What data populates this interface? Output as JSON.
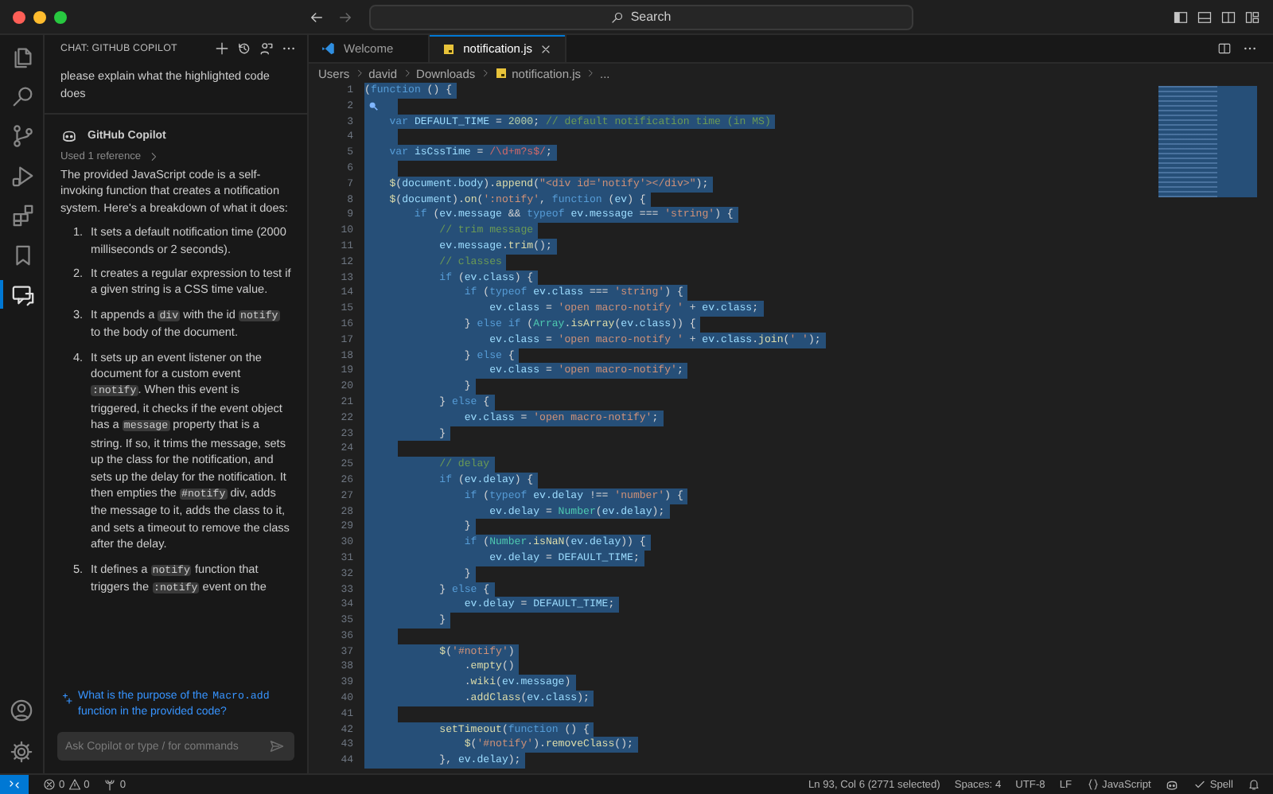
{
  "title_bar": {
    "search_label": "Search"
  },
  "activity_bar": {
    "items": [
      {
        "kind": "files",
        "selected": false
      },
      {
        "kind": "search",
        "selected": false
      },
      {
        "kind": "source-control",
        "selected": false
      },
      {
        "kind": "run",
        "selected": false
      },
      {
        "kind": "extensions",
        "selected": false
      },
      {
        "kind": "bookmark",
        "selected": false
      },
      {
        "kind": "chat",
        "selected": true
      }
    ],
    "bottom": [
      {
        "kind": "account"
      },
      {
        "kind": "settings"
      }
    ]
  },
  "chat": {
    "title": "CHAT: GITHUB COPILOT",
    "question": "please explain what the highlighted code does",
    "response": {
      "author": "GitHub Copilot",
      "reference": "Used 1 reference",
      "intro": "The provided JavaScript code is a self-invoking function that creates a notification system. Here's a breakdown of what it does:",
      "steps": [
        {
          "number": "1.",
          "parts": [
            {
              "kind": "text",
              "text": "It sets a default notification time (2000 milliseconds or 2 seconds)."
            }
          ]
        },
        {
          "number": "2.",
          "parts": [
            {
              "kind": "text",
              "text": "It creates a regular expression to test if a given string is a CSS time value."
            }
          ]
        },
        {
          "number": "3.",
          "parts": [
            {
              "kind": "text",
              "text": "It appends a "
            },
            {
              "kind": "code",
              "text": "div"
            },
            {
              "kind": "text",
              "text": " with the id "
            },
            {
              "kind": "code",
              "text": "notify"
            },
            {
              "kind": "text",
              "text": " to the body of the document."
            }
          ]
        },
        {
          "number": "4.",
          "parts": [
            {
              "kind": "text",
              "text": "It sets up an event listener on the document for a custom event "
            },
            {
              "kind": "code",
              "text": ":notify"
            },
            {
              "kind": "text",
              "text": ". When this event is triggered, it checks if the event object has a "
            },
            {
              "kind": "code",
              "text": "message"
            },
            {
              "kind": "text",
              "text": " property that is a string. If so, it trims the message, sets up the class for the notification, and sets up the delay for the notification. It then empties the "
            },
            {
              "kind": "code",
              "text": "#notify"
            },
            {
              "kind": "text",
              "text": " div, adds the message to it, adds the class to it, and sets a timeout to remove the class after the delay."
            }
          ]
        },
        {
          "number": "5.",
          "parts": [
            {
              "kind": "text",
              "text": "It defines a "
            },
            {
              "kind": "code",
              "text": "notify"
            },
            {
              "kind": "text",
              "text": " function that triggers the "
            },
            {
              "kind": "code",
              "text": ":notify"
            },
            {
              "kind": "text",
              "text": " event on the"
            }
          ]
        }
      ]
    },
    "followup": [
      {
        "kind": "text",
        "text": "What is the purpose of the "
      },
      {
        "kind": "code",
        "text": "Macro.add"
      },
      {
        "kind": "text",
        "text": " function in the provided code?"
      }
    ],
    "input": {
      "placeholder": "Ask Copilot or type / for commands"
    }
  },
  "editor": {
    "tabs": [
      {
        "label": "Welcome",
        "kind": "welcome",
        "selected": false
      },
      {
        "label": "notification.js",
        "kind": "js",
        "selected": true
      }
    ],
    "breadcrumb": [
      {
        "label": "Users",
        "kind": "folder"
      },
      {
        "label": "david",
        "kind": "folder"
      },
      {
        "label": "Downloads",
        "kind": "folder"
      },
      {
        "label": "notification.js",
        "kind": "js"
      },
      {
        "label": "...",
        "kind": "more"
      }
    ],
    "lines": [
      {
        "number": "1",
        "selected": true,
        "hint": false,
        "tokens": [
          {
            "kind": "p",
            "text": "("
          },
          {
            "kind": "kw",
            "text": "function"
          },
          {
            "kind": "p",
            "text": " () {"
          }
        ]
      },
      {
        "number": "2",
        "selected": true,
        "hint": true
      },
      {
        "number": "3",
        "selected": true,
        "hint": false,
        "tokens": [
          {
            "kind": "kw",
            "text": "    var"
          },
          {
            "kind": "vr",
            "text": " DEFAULT_TIME"
          },
          {
            "kind": "p",
            "text": " ="
          },
          {
            "kind": "nm",
            "text": " 2000"
          },
          {
            "kind": "p",
            "text": ";"
          },
          {
            "kind": "cm",
            "text": " // default notification time (in MS)"
          }
        ]
      },
      {
        "number": "4",
        "selected": true,
        "hint": false
      },
      {
        "number": "5",
        "selected": true,
        "hint": false,
        "tokens": [
          {
            "kind": "kw",
            "text": "    var"
          },
          {
            "kind": "vr",
            "text": " isCssTime"
          },
          {
            "kind": "p",
            "text": " ="
          },
          {
            "kind": "re",
            "text": " /\\d+m?s$/"
          },
          {
            "kind": "p",
            "text": ";"
          }
        ]
      },
      {
        "number": "6",
        "selected": true,
        "hint": false
      },
      {
        "number": "7",
        "selected": true,
        "hint": false,
        "tokens": [
          {
            "kind": "fn",
            "text": "    $"
          },
          {
            "kind": "p",
            "text": "("
          },
          {
            "kind": "vr",
            "text": "document.body"
          },
          {
            "kind": "p",
            "text": ")."
          },
          {
            "kind": "fn",
            "text": "append"
          },
          {
            "kind": "p",
            "text": "("
          },
          {
            "kind": "st",
            "text": "\"<div id='notify'></div>\""
          },
          {
            "kind": "p",
            "text": ");"
          }
        ]
      },
      {
        "number": "8",
        "selected": true,
        "hint": false,
        "tokens": [
          {
            "kind": "fn",
            "text": "    $"
          },
          {
            "kind": "p",
            "text": "("
          },
          {
            "kind": "vr",
            "text": "document"
          },
          {
            "kind": "p",
            "text": ")."
          },
          {
            "kind": "fn",
            "text": "on"
          },
          {
            "kind": "p",
            "text": "("
          },
          {
            "kind": "st",
            "text": "':notify'"
          },
          {
            "kind": "p",
            "text": ","
          },
          {
            "kind": "kw",
            "text": " function"
          },
          {
            "kind": "p",
            "text": " ("
          },
          {
            "kind": "vr",
            "text": "ev"
          },
          {
            "kind": "p",
            "text": ") {"
          }
        ]
      },
      {
        "number": "9",
        "selected": true,
        "hint": false,
        "tokens": [
          {
            "kind": "kw",
            "text": "        if"
          },
          {
            "kind": "p",
            "text": " ("
          },
          {
            "kind": "vr",
            "text": "ev.message"
          },
          {
            "kind": "p",
            "text": " &&"
          },
          {
            "kind": "kw",
            "text": " typeof"
          },
          {
            "kind": "vr",
            "text": " ev.message"
          },
          {
            "kind": "p",
            "text": " ==="
          },
          {
            "kind": "st",
            "text": " 'string'"
          },
          {
            "kind": "p",
            "text": ") {"
          }
        ]
      },
      {
        "number": "10",
        "selected": true,
        "hint": false,
        "tokens": [
          {
            "kind": "cm",
            "text": "            // trim message"
          }
        ]
      },
      {
        "number": "11",
        "selected": true,
        "hint": false,
        "tokens": [
          {
            "kind": "vr",
            "text": "            ev.message"
          },
          {
            "kind": "p",
            "text": "."
          },
          {
            "kind": "fn",
            "text": "trim"
          },
          {
            "kind": "p",
            "text": "();"
          }
        ]
      },
      {
        "number": "12",
        "selected": true,
        "hint": false,
        "tokens": [
          {
            "kind": "cm",
            "text": "            // classes"
          }
        ]
      },
      {
        "number": "13",
        "selected": true,
        "hint": false,
        "tokens": [
          {
            "kind": "kw",
            "text": "            if"
          },
          {
            "kind": "p",
            "text": " ("
          },
          {
            "kind": "vr",
            "text": "ev.class"
          },
          {
            "kind": "p",
            "text": ") {"
          }
        ]
      },
      {
        "number": "14",
        "selected": true,
        "hint": false,
        "tokens": [
          {
            "kind": "kw",
            "text": "                if"
          },
          {
            "kind": "p",
            "text": " ("
          },
          {
            "kind": "kw",
            "text": "typeof"
          },
          {
            "kind": "vr",
            "text": " ev.class"
          },
          {
            "kind": "p",
            "text": " ==="
          },
          {
            "kind": "st",
            "text": " 'string'"
          },
          {
            "kind": "p",
            "text": ") {"
          }
        ]
      },
      {
        "number": "15",
        "selected": true,
        "hint": false,
        "tokens": [
          {
            "kind": "vr",
            "text": "                    ev.class"
          },
          {
            "kind": "p",
            "text": " ="
          },
          {
            "kind": "st",
            "text": " 'open macro-notify '"
          },
          {
            "kind": "p",
            "text": " +"
          },
          {
            "kind": "vr",
            "text": " ev.class"
          },
          {
            "kind": "p",
            "text": ";"
          }
        ]
      },
      {
        "number": "16",
        "selected": true,
        "hint": false,
        "tokens": [
          {
            "kind": "p",
            "text": "                }"
          },
          {
            "kind": "kw",
            "text": " else if"
          },
          {
            "kind": "p",
            "text": " ("
          },
          {
            "kind": "ty",
            "text": "Array"
          },
          {
            "kind": "p",
            "text": "."
          },
          {
            "kind": "fn",
            "text": "isArray"
          },
          {
            "kind": "p",
            "text": "("
          },
          {
            "kind": "vr",
            "text": "ev.class"
          },
          {
            "kind": "p",
            "text": ")) {"
          }
        ]
      },
      {
        "number": "17",
        "selected": true,
        "hint": false,
        "tokens": [
          {
            "kind": "vr",
            "text": "                    ev.class"
          },
          {
            "kind": "p",
            "text": " ="
          },
          {
            "kind": "st",
            "text": " 'open macro-notify '"
          },
          {
            "kind": "p",
            "text": " +"
          },
          {
            "kind": "vr",
            "text": " ev.class"
          },
          {
            "kind": "p",
            "text": "."
          },
          {
            "kind": "fn",
            "text": "join"
          },
          {
            "kind": "p",
            "text": "("
          },
          {
            "kind": "st",
            "text": "' '"
          },
          {
            "kind": "p",
            "text": ");"
          }
        ]
      },
      {
        "number": "18",
        "selected": true,
        "hint": false,
        "tokens": [
          {
            "kind": "p",
            "text": "                }"
          },
          {
            "kind": "kw",
            "text": " else"
          },
          {
            "kind": "p",
            "text": " {"
          }
        ]
      },
      {
        "number": "19",
        "selected": true,
        "hint": false,
        "tokens": [
          {
            "kind": "vr",
            "text": "                    ev.class"
          },
          {
            "kind": "p",
            "text": " ="
          },
          {
            "kind": "st",
            "text": " 'open macro-notify'"
          },
          {
            "kind": "p",
            "text": ";"
          }
        ]
      },
      {
        "number": "20",
        "selected": true,
        "hint": false,
        "tokens": [
          {
            "kind": "p",
            "text": "                }"
          }
        ]
      },
      {
        "number": "21",
        "selected": true,
        "hint": false,
        "tokens": [
          {
            "kind": "p",
            "text": "            }"
          },
          {
            "kind": "kw",
            "text": " else"
          },
          {
            "kind": "p",
            "text": " {"
          }
        ]
      },
      {
        "number": "22",
        "selected": true,
        "hint": false,
        "tokens": [
          {
            "kind": "vr",
            "text": "                ev.class"
          },
          {
            "kind": "p",
            "text": " ="
          },
          {
            "kind": "st",
            "text": " 'open macro-notify'"
          },
          {
            "kind": "p",
            "text": ";"
          }
        ]
      },
      {
        "number": "23",
        "selected": true,
        "hint": false,
        "tokens": [
          {
            "kind": "p",
            "text": "            }"
          }
        ]
      },
      {
        "number": "24",
        "selected": true,
        "hint": false
      },
      {
        "number": "25",
        "selected": true,
        "hint": false,
        "tokens": [
          {
            "kind": "cm",
            "text": "            // delay"
          }
        ]
      },
      {
        "number": "26",
        "selected": true,
        "hint": false,
        "tokens": [
          {
            "kind": "kw",
            "text": "            if"
          },
          {
            "kind": "p",
            "text": " ("
          },
          {
            "kind": "vr",
            "text": "ev.delay"
          },
          {
            "kind": "p",
            "text": ") {"
          }
        ]
      },
      {
        "number": "27",
        "selected": true,
        "hint": false,
        "tokens": [
          {
            "kind": "kw",
            "text": "                if"
          },
          {
            "kind": "p",
            "text": " ("
          },
          {
            "kind": "kw",
            "text": "typeof"
          },
          {
            "kind": "vr",
            "text": " ev.delay"
          },
          {
            "kind": "p",
            "text": " !=="
          },
          {
            "kind": "st",
            "text": " 'number'"
          },
          {
            "kind": "p",
            "text": ") {"
          }
        ]
      },
      {
        "number": "28",
        "selected": true,
        "hint": false,
        "tokens": [
          {
            "kind": "vr",
            "text": "                    ev.delay"
          },
          {
            "kind": "p",
            "text": " ="
          },
          {
            "kind": "ty",
            "text": " Number"
          },
          {
            "kind": "p",
            "text": "("
          },
          {
            "kind": "vr",
            "text": "ev.delay"
          },
          {
            "kind": "p",
            "text": ");"
          }
        ]
      },
      {
        "number": "29",
        "selected": true,
        "hint": false,
        "tokens": [
          {
            "kind": "p",
            "text": "                }"
          }
        ]
      },
      {
        "number": "30",
        "selected": true,
        "hint": false,
        "tokens": [
          {
            "kind": "kw",
            "text": "                if"
          },
          {
            "kind": "p",
            "text": " ("
          },
          {
            "kind": "ty",
            "text": "Number"
          },
          {
            "kind": "p",
            "text": "."
          },
          {
            "kind": "fn",
            "text": "isNaN"
          },
          {
            "kind": "p",
            "text": "("
          },
          {
            "kind": "vr",
            "text": "ev.delay"
          },
          {
            "kind": "p",
            "text": ")) {"
          }
        ]
      },
      {
        "number": "31",
        "selected": true,
        "hint": false,
        "tokens": [
          {
            "kind": "vr",
            "text": "                    ev.delay"
          },
          {
            "kind": "p",
            "text": " ="
          },
          {
            "kind": "vr",
            "text": " DEFAULT_TIME"
          },
          {
            "kind": "p",
            "text": ";"
          }
        ]
      },
      {
        "number": "32",
        "selected": true,
        "hint": false,
        "tokens": [
          {
            "kind": "p",
            "text": "                }"
          }
        ]
      },
      {
        "number": "33",
        "selected": true,
        "hint": false,
        "tokens": [
          {
            "kind": "p",
            "text": "            }"
          },
          {
            "kind": "kw",
            "text": " else"
          },
          {
            "kind": "p",
            "text": " {"
          }
        ]
      },
      {
        "number": "34",
        "selected": true,
        "hint": false,
        "tokens": [
          {
            "kind": "vr",
            "text": "                ev.delay"
          },
          {
            "kind": "p",
            "text": " ="
          },
          {
            "kind": "vr",
            "text": " DEFAULT_TIME"
          },
          {
            "kind": "p",
            "text": ";"
          }
        ]
      },
      {
        "number": "35",
        "selected": true,
        "hint": false,
        "tokens": [
          {
            "kind": "p",
            "text": "            }"
          }
        ]
      },
      {
        "number": "36",
        "selected": true,
        "hint": false
      },
      {
        "number": "37",
        "selected": true,
        "hint": false,
        "tokens": [
          {
            "kind": "fn",
            "text": "            $"
          },
          {
            "kind": "p",
            "text": "("
          },
          {
            "kind": "st",
            "text": "'#notify'"
          },
          {
            "kind": "p",
            "text": ")"
          }
        ]
      },
      {
        "number": "38",
        "selected": true,
        "hint": false,
        "tokens": [
          {
            "kind": "p",
            "text": "                ."
          },
          {
            "kind": "fn",
            "text": "empty"
          },
          {
            "kind": "p",
            "text": "()"
          }
        ]
      },
      {
        "number": "39",
        "selected": true,
        "hint": false,
        "tokens": [
          {
            "kind": "p",
            "text": "                ."
          },
          {
            "kind": "fn",
            "text": "wiki"
          },
          {
            "kind": "p",
            "text": "("
          },
          {
            "kind": "vr",
            "text": "ev.message"
          },
          {
            "kind": "p",
            "text": ")"
          }
        ]
      },
      {
        "number": "40",
        "selected": true,
        "hint": false,
        "tokens": [
          {
            "kind": "p",
            "text": "                ."
          },
          {
            "kind": "fn",
            "text": "addClass"
          },
          {
            "kind": "p",
            "text": "("
          },
          {
            "kind": "vr",
            "text": "ev.class"
          },
          {
            "kind": "p",
            "text": ");"
          }
        ]
      },
      {
        "number": "41",
        "selected": true,
        "hint": false
      },
      {
        "number": "42",
        "selected": true,
        "hint": false,
        "tokens": [
          {
            "kind": "fn",
            "text": "            setTimeout"
          },
          {
            "kind": "p",
            "text": "("
          },
          {
            "kind": "kw",
            "text": "function"
          },
          {
            "kind": "p",
            "text": " () {"
          }
        ]
      },
      {
        "number": "43",
        "selected": true,
        "hint": false,
        "tokens": [
          {
            "kind": "fn",
            "text": "                $"
          },
          {
            "kind": "p",
            "text": "("
          },
          {
            "kind": "st",
            "text": "'#notify'"
          },
          {
            "kind": "p",
            "text": ")."
          },
          {
            "kind": "fn",
            "text": "removeClass"
          },
          {
            "kind": "p",
            "text": "();"
          }
        ]
      },
      {
        "number": "44",
        "selected": true,
        "hint": false,
        "tokens": [
          {
            "kind": "p",
            "text": "            },"
          },
          {
            "kind": "vr",
            "text": " ev.delay"
          },
          {
            "kind": "p",
            "text": ");"
          }
        ]
      }
    ]
  },
  "status_bar": {
    "errors": "0",
    "warnings": "0",
    "ports": "0",
    "position": "Ln 93, Col 6 (2771 selected)",
    "indent": "Spaces: 4",
    "encoding": "UTF-8",
    "eol": "LF",
    "language": "JavaScript",
    "spell": "Spell"
  }
}
